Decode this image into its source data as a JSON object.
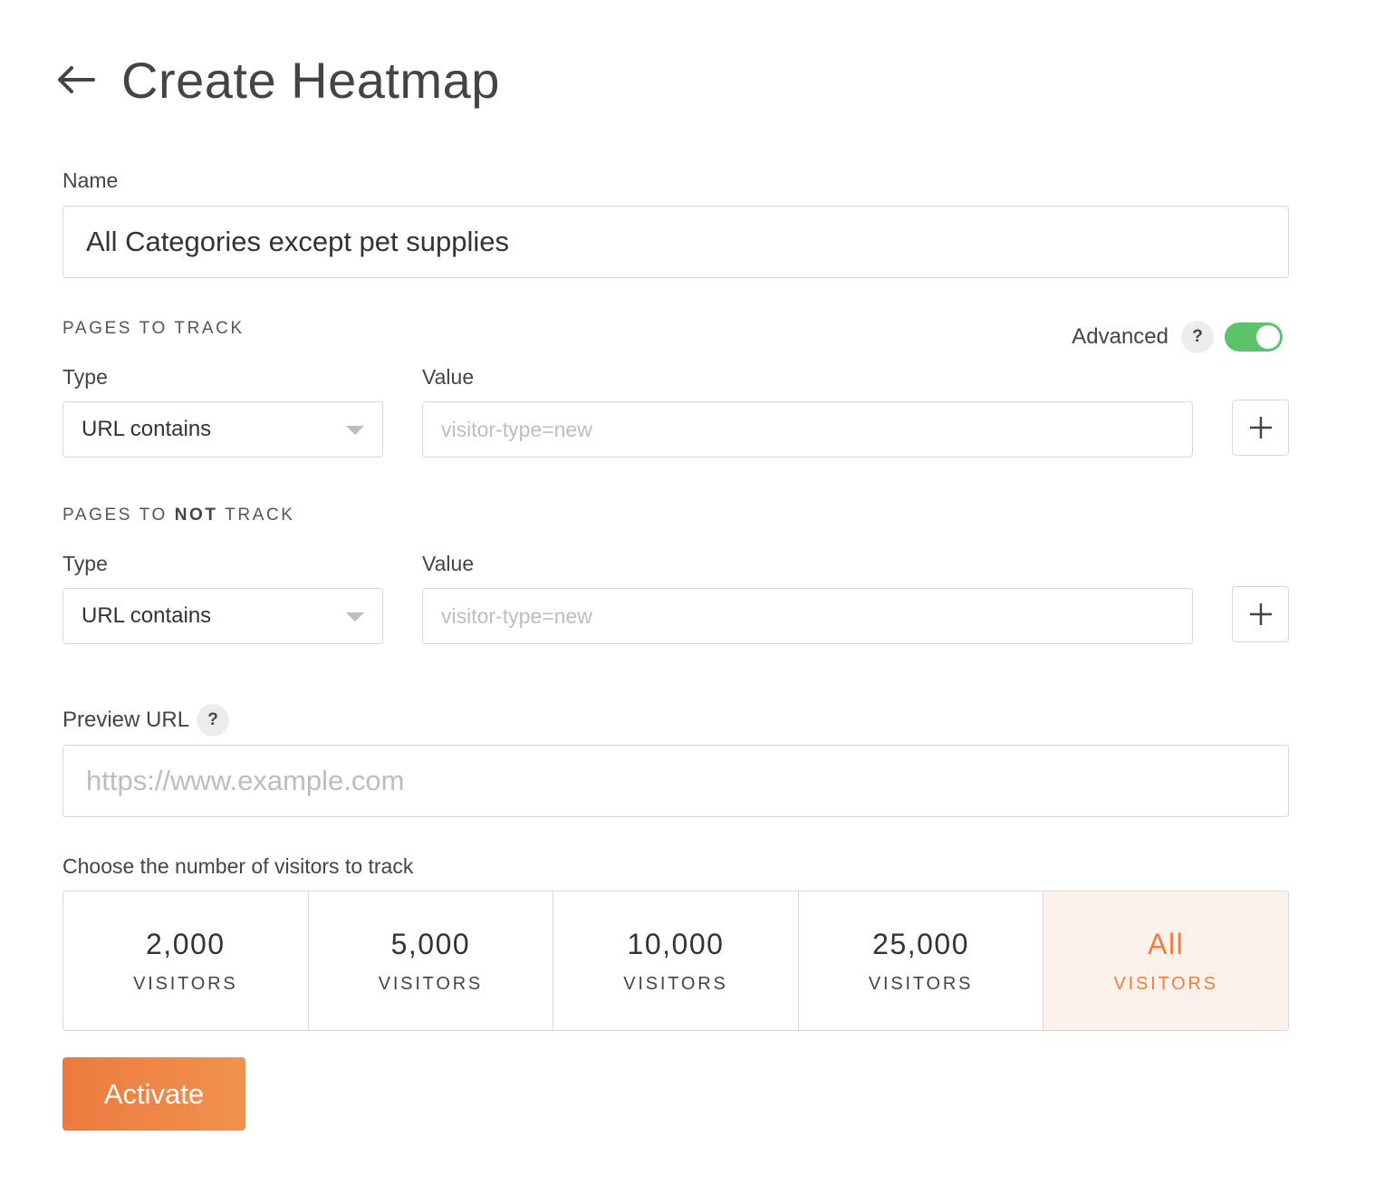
{
  "header": {
    "title": "Create Heatmap",
    "back_icon": "arrow-left-icon"
  },
  "name": {
    "label": "Name",
    "value": "All Categories except pet supplies"
  },
  "pages_to_track": {
    "heading": "PAGES TO TRACK",
    "advanced_label": "Advanced",
    "advanced_enabled": true,
    "help_glyph": "?",
    "type_label": "Type",
    "value_label": "Value",
    "type_selected": "URL contains",
    "value_placeholder": "visitor-type=new"
  },
  "pages_to_not_track": {
    "heading_prefix": "PAGES TO ",
    "heading_emphasis": "NOT",
    "heading_suffix": " TRACK",
    "type_label": "Type",
    "value_label": "Value",
    "type_selected": "URL contains",
    "value_placeholder": "visitor-type=new"
  },
  "preview": {
    "label": "Preview URL",
    "help_glyph": "?",
    "placeholder": "https://www.example.com"
  },
  "visitors": {
    "label": "Choose the number of visitors to track",
    "options": [
      {
        "value": "2,000",
        "unit": "VISITORS",
        "selected": false
      },
      {
        "value": "5,000",
        "unit": "VISITORS",
        "selected": false
      },
      {
        "value": "10,000",
        "unit": "VISITORS",
        "selected": false
      },
      {
        "value": "25,000",
        "unit": "VISITORS",
        "selected": false
      },
      {
        "value": "All",
        "unit": "VISITORS",
        "selected": true
      }
    ]
  },
  "activate_label": "Activate",
  "colors": {
    "accent": "#ee7d3f",
    "toggle_on": "#5cc36b",
    "selected_bg": "#fdf1ec"
  }
}
